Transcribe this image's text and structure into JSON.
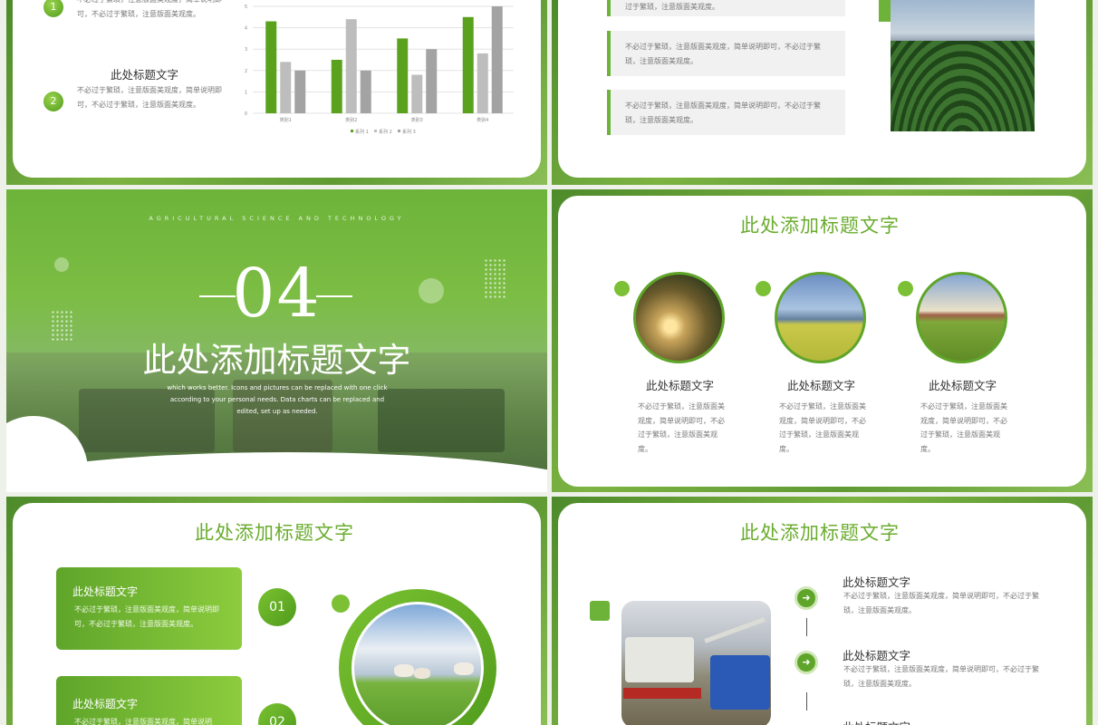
{
  "slide1": {
    "items": [
      {
        "num": "1",
        "title": "",
        "text": "不必过于繁琐，注意版面美观度，简单说明即可，不必过于繁琐，注意版面美观度。"
      },
      {
        "num": "2",
        "title": "此处标题文字",
        "text": "不必过于繁琐，注意版面美观度，简单说明即可，不必过于繁琐，注意版面美观度。"
      }
    ],
    "chart_data": {
      "type": "bar",
      "categories": [
        "类别1",
        "类别2",
        "类别3",
        "类别4"
      ],
      "series": [
        {
          "name": "系列 1",
          "values": [
            4.3,
            2.5,
            3.5,
            4.5
          ]
        },
        {
          "name": "系列 2",
          "values": [
            2.4,
            4.4,
            1.8,
            2.8
          ]
        },
        {
          "name": "系列 3",
          "values": [
            2.0,
            2.0,
            3.0,
            5.0
          ]
        }
      ],
      "ylim": [
        0,
        5
      ],
      "yticks": [
        "0",
        "1",
        "2",
        "3",
        "4",
        "5"
      ],
      "colors": [
        "#5aa21e",
        "#bdbdbd",
        "#a3a3a3"
      ],
      "grid": true,
      "legend": "bottom"
    }
  },
  "slide2": {
    "boxes": [
      {
        "text": "过于繁琐，注意版面美观度。"
      },
      {
        "text": "不必过于繁琐，注意版面美观度，简单说明即可，不必过于繁琐，注意版面美观度。"
      },
      {
        "text": "不必过于繁琐，注意版面美观度，简单说明即可，不必过于繁琐，注意版面美观度。"
      }
    ]
  },
  "slide3": {
    "subtitle": "AGRICULTURAL SCIENCE AND TECHNOLOGY",
    "number": "04",
    "title": "此处添加标题文字",
    "desc": "which works better. Icons and pictures can be replaced with one click according to your personal needs. Data charts can be replaced and edited, set up as needed."
  },
  "slide4": {
    "title": "此处添加标题文字",
    "items": [
      {
        "title": "此处标题文字",
        "text": "不必过于繁琐，注意版面美观度，简单说明即可，不必过于繁琐，注意版面美观度。"
      },
      {
        "title": "此处标题文字",
        "text": "不必过于繁琐，注意版面美观度，简单说明即可，不必过于繁琐，注意版面美观度。"
      },
      {
        "title": "此处标题文字",
        "text": "不必过于繁琐，注意版面美观度，简单说明即可，不必过于繁琐，注意版面美观度。"
      }
    ]
  },
  "slide5": {
    "title": "此处添加标题文字",
    "items": [
      {
        "num": "01",
        "title": "此处标题文字",
        "text": "不必过于繁琐，注意版面美观度，简单说明即可，不必过于繁琐，注意版面美观度。"
      },
      {
        "num": "02",
        "title": "此处标题文字",
        "text": "不必过于繁琐，注意版面美观度，简单说明"
      }
    ]
  },
  "slide6": {
    "title": "此处添加标题文字",
    "items": [
      {
        "title": "此处标题文字",
        "text": "不必过于繁琐，注意版面美观度，简单说明即可，不必过于繁琐，注意版面美观度。"
      },
      {
        "title": "此处标题文字",
        "text": "不必过于繁琐，注意版面美观度，简单说明即可，不必过于繁琐，注意版面美观度。"
      },
      {
        "title": "此处标题文字",
        "text": ""
      }
    ]
  }
}
